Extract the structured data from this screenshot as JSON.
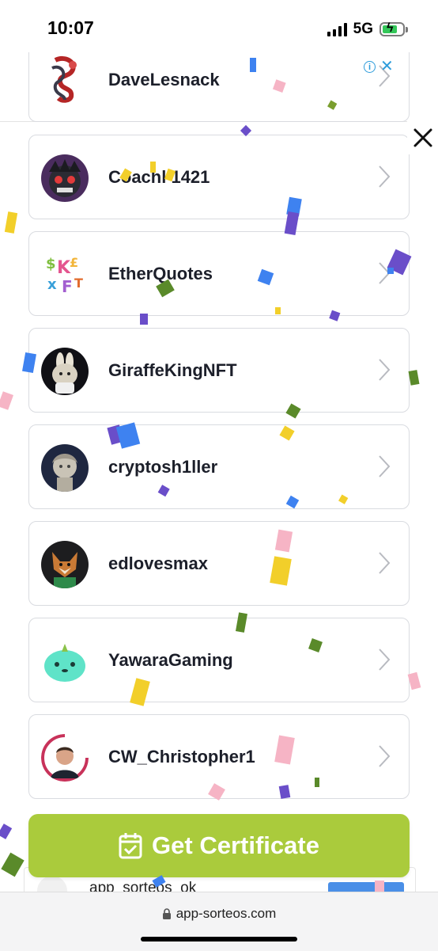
{
  "status_bar": {
    "time": "10:07",
    "network": "5G"
  },
  "users": [
    {
      "name": "DaveLesnack",
      "avatar": "tattoo-art-avatar"
    },
    {
      "name": "Coachl 1421",
      "avatar": "robot-avatar"
    },
    {
      "name": "EtherQuotes",
      "avatar": "colorful-letters-avatar"
    },
    {
      "name": "GiraffeKingNFT",
      "avatar": "astronaut-animal-avatar"
    },
    {
      "name": "cryptosh1ller",
      "avatar": "statue-avatar"
    },
    {
      "name": "edlovesmax",
      "avatar": "fox-avatar"
    },
    {
      "name": "YawaraGaming",
      "avatar": "green-creature-avatar"
    },
    {
      "name": "CW_Christopher1",
      "avatar": "man-photo-avatar"
    }
  ],
  "cta": {
    "label": "Get Certificate"
  },
  "ad_strip": {
    "text": "app_sorteos_ok"
  },
  "browser": {
    "url": "app-sorteos.com"
  },
  "colors": {
    "cta": "#aacb3c",
    "accent_blue": "#2d9cdb"
  }
}
